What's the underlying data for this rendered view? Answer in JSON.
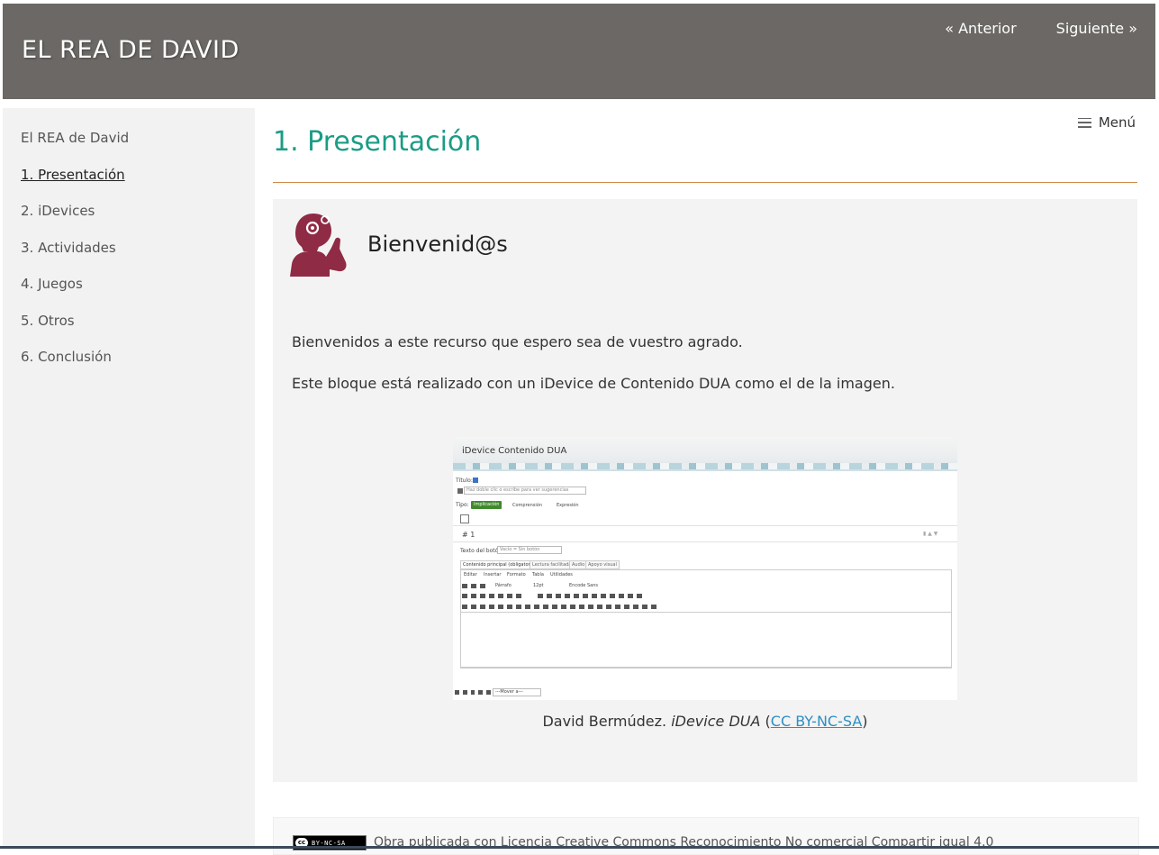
{
  "header": {
    "site_title": "EL REA DE DAVID",
    "prev_label": "« Anterior",
    "next_label": "Siguiente »"
  },
  "sidebar": {
    "items": [
      {
        "label": "El REA de David"
      },
      {
        "label": "1. Presentación",
        "active": true
      },
      {
        "label": "2. iDevices"
      },
      {
        "label": "3. Actividades"
      },
      {
        "label": "4. Juegos"
      },
      {
        "label": "5. Otros"
      },
      {
        "label": "6. Conclusión"
      }
    ]
  },
  "menu": {
    "label": "Menú"
  },
  "page": {
    "title": "1. Presentación"
  },
  "idevice": {
    "title": "Bienvenid@s",
    "paragraphs": [
      "Bienvenidos a este recurso que espero sea de vuestro agrado.",
      "Este bloque está realizado con un iDevice de Contenido DUA como el de la imagen."
    ],
    "figure": {
      "shot_title": "iDevice Contenido DUA",
      "title_label": "Título:",
      "title_placeholder": "Haz doble clic o escribe para ver sugerencias",
      "type_label": "Tipo:",
      "type_options": [
        "Implicación",
        "Comprensión",
        "Expresión"
      ],
      "block_number": "# 1",
      "button_text_label": "Texto del botón:",
      "button_text_placeholder": "Vacío = Sin botón",
      "tabs": [
        "Contenido principal (obligatorio)",
        "Lectura facilitada",
        "Audio",
        "Apoyo visual"
      ],
      "menus": [
        "Editar",
        "Insertar",
        "Formato",
        "Tabla",
        "Utilidades"
      ],
      "format_select": "Párrafo",
      "size_select": "12pt",
      "font_select": "Encode Sans",
      "move_select": "---Mover a---"
    },
    "caption": {
      "author": "David Bermúdez.",
      "work": "iDevice DUA",
      "open_paren": "(",
      "license_link": "CC BY-NC-SA",
      "close_paren": ")"
    }
  },
  "license": {
    "badge_cc": "cc",
    "badge_text": "BY-NC-SA",
    "text": "Obra publicada con Licencia Creative Commons Reconocimiento No comercial Compartir igual 4.0"
  },
  "colors": {
    "header_bg": "#6b6865",
    "title_accent": "#1b9c86",
    "rule": "#d08a48",
    "icon": "#8f2b45",
    "link": "#2d8fc4"
  }
}
